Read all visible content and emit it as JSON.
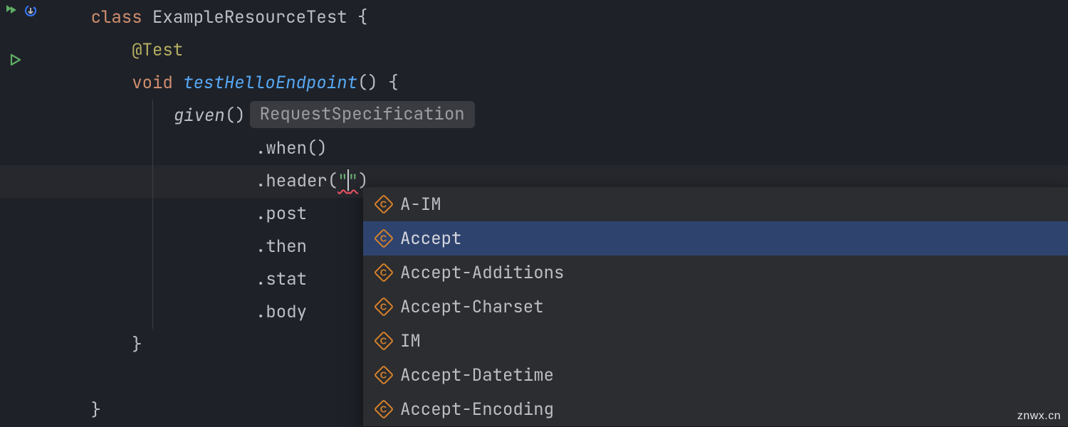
{
  "gutter": {
    "run_all_icon": "run-all-icon",
    "reload_icon": "reload-icon",
    "run_icon": "run-icon"
  },
  "code": {
    "l1": {
      "kw_class": "class",
      "name": "ExampleResourceTest",
      "brace": " {"
    },
    "l2": {
      "annotation": "@Test"
    },
    "l3": {
      "kw_void": "void",
      "method": "testHelloEndpoint",
      "parens": "()",
      "brace": " {"
    },
    "l4": {
      "given": "given",
      "parens": "()",
      "hint": "RequestSpecification"
    },
    "l5": {
      "dot": ".",
      "m": "when",
      "parens": "()"
    },
    "l6": {
      "dot": ".",
      "m": "header",
      "open": "(",
      "qo": "\"",
      "qc": "\"",
      "close": ")"
    },
    "l7": {
      "dot": ".",
      "m": "post"
    },
    "l8": {
      "dot": ".",
      "m": "then"
    },
    "l9": {
      "dot": ".",
      "m": "stat"
    },
    "l10": {
      "dot": ".",
      "m": "body"
    },
    "l11": {
      "brace": "}"
    },
    "l12": "",
    "l13": {
      "brace": "}"
    }
  },
  "popup": {
    "items": [
      {
        "label": "A-IM",
        "selected": false
      },
      {
        "label": "Accept",
        "selected": true
      },
      {
        "label": "Accept-Additions",
        "selected": false
      },
      {
        "label": "Accept-Charset",
        "selected": false
      },
      {
        "label": "IM",
        "selected": false
      },
      {
        "label": "Accept-Datetime",
        "selected": false
      },
      {
        "label": "Accept-Encoding",
        "selected": false
      }
    ]
  },
  "accent": {
    "keyword": "#cf8e6d",
    "annotation": "#b3ae60",
    "method_call": "#56a8f5",
    "selection": "#2e436e",
    "icon": "#d9822b"
  },
  "watermark": "znwx.cn"
}
